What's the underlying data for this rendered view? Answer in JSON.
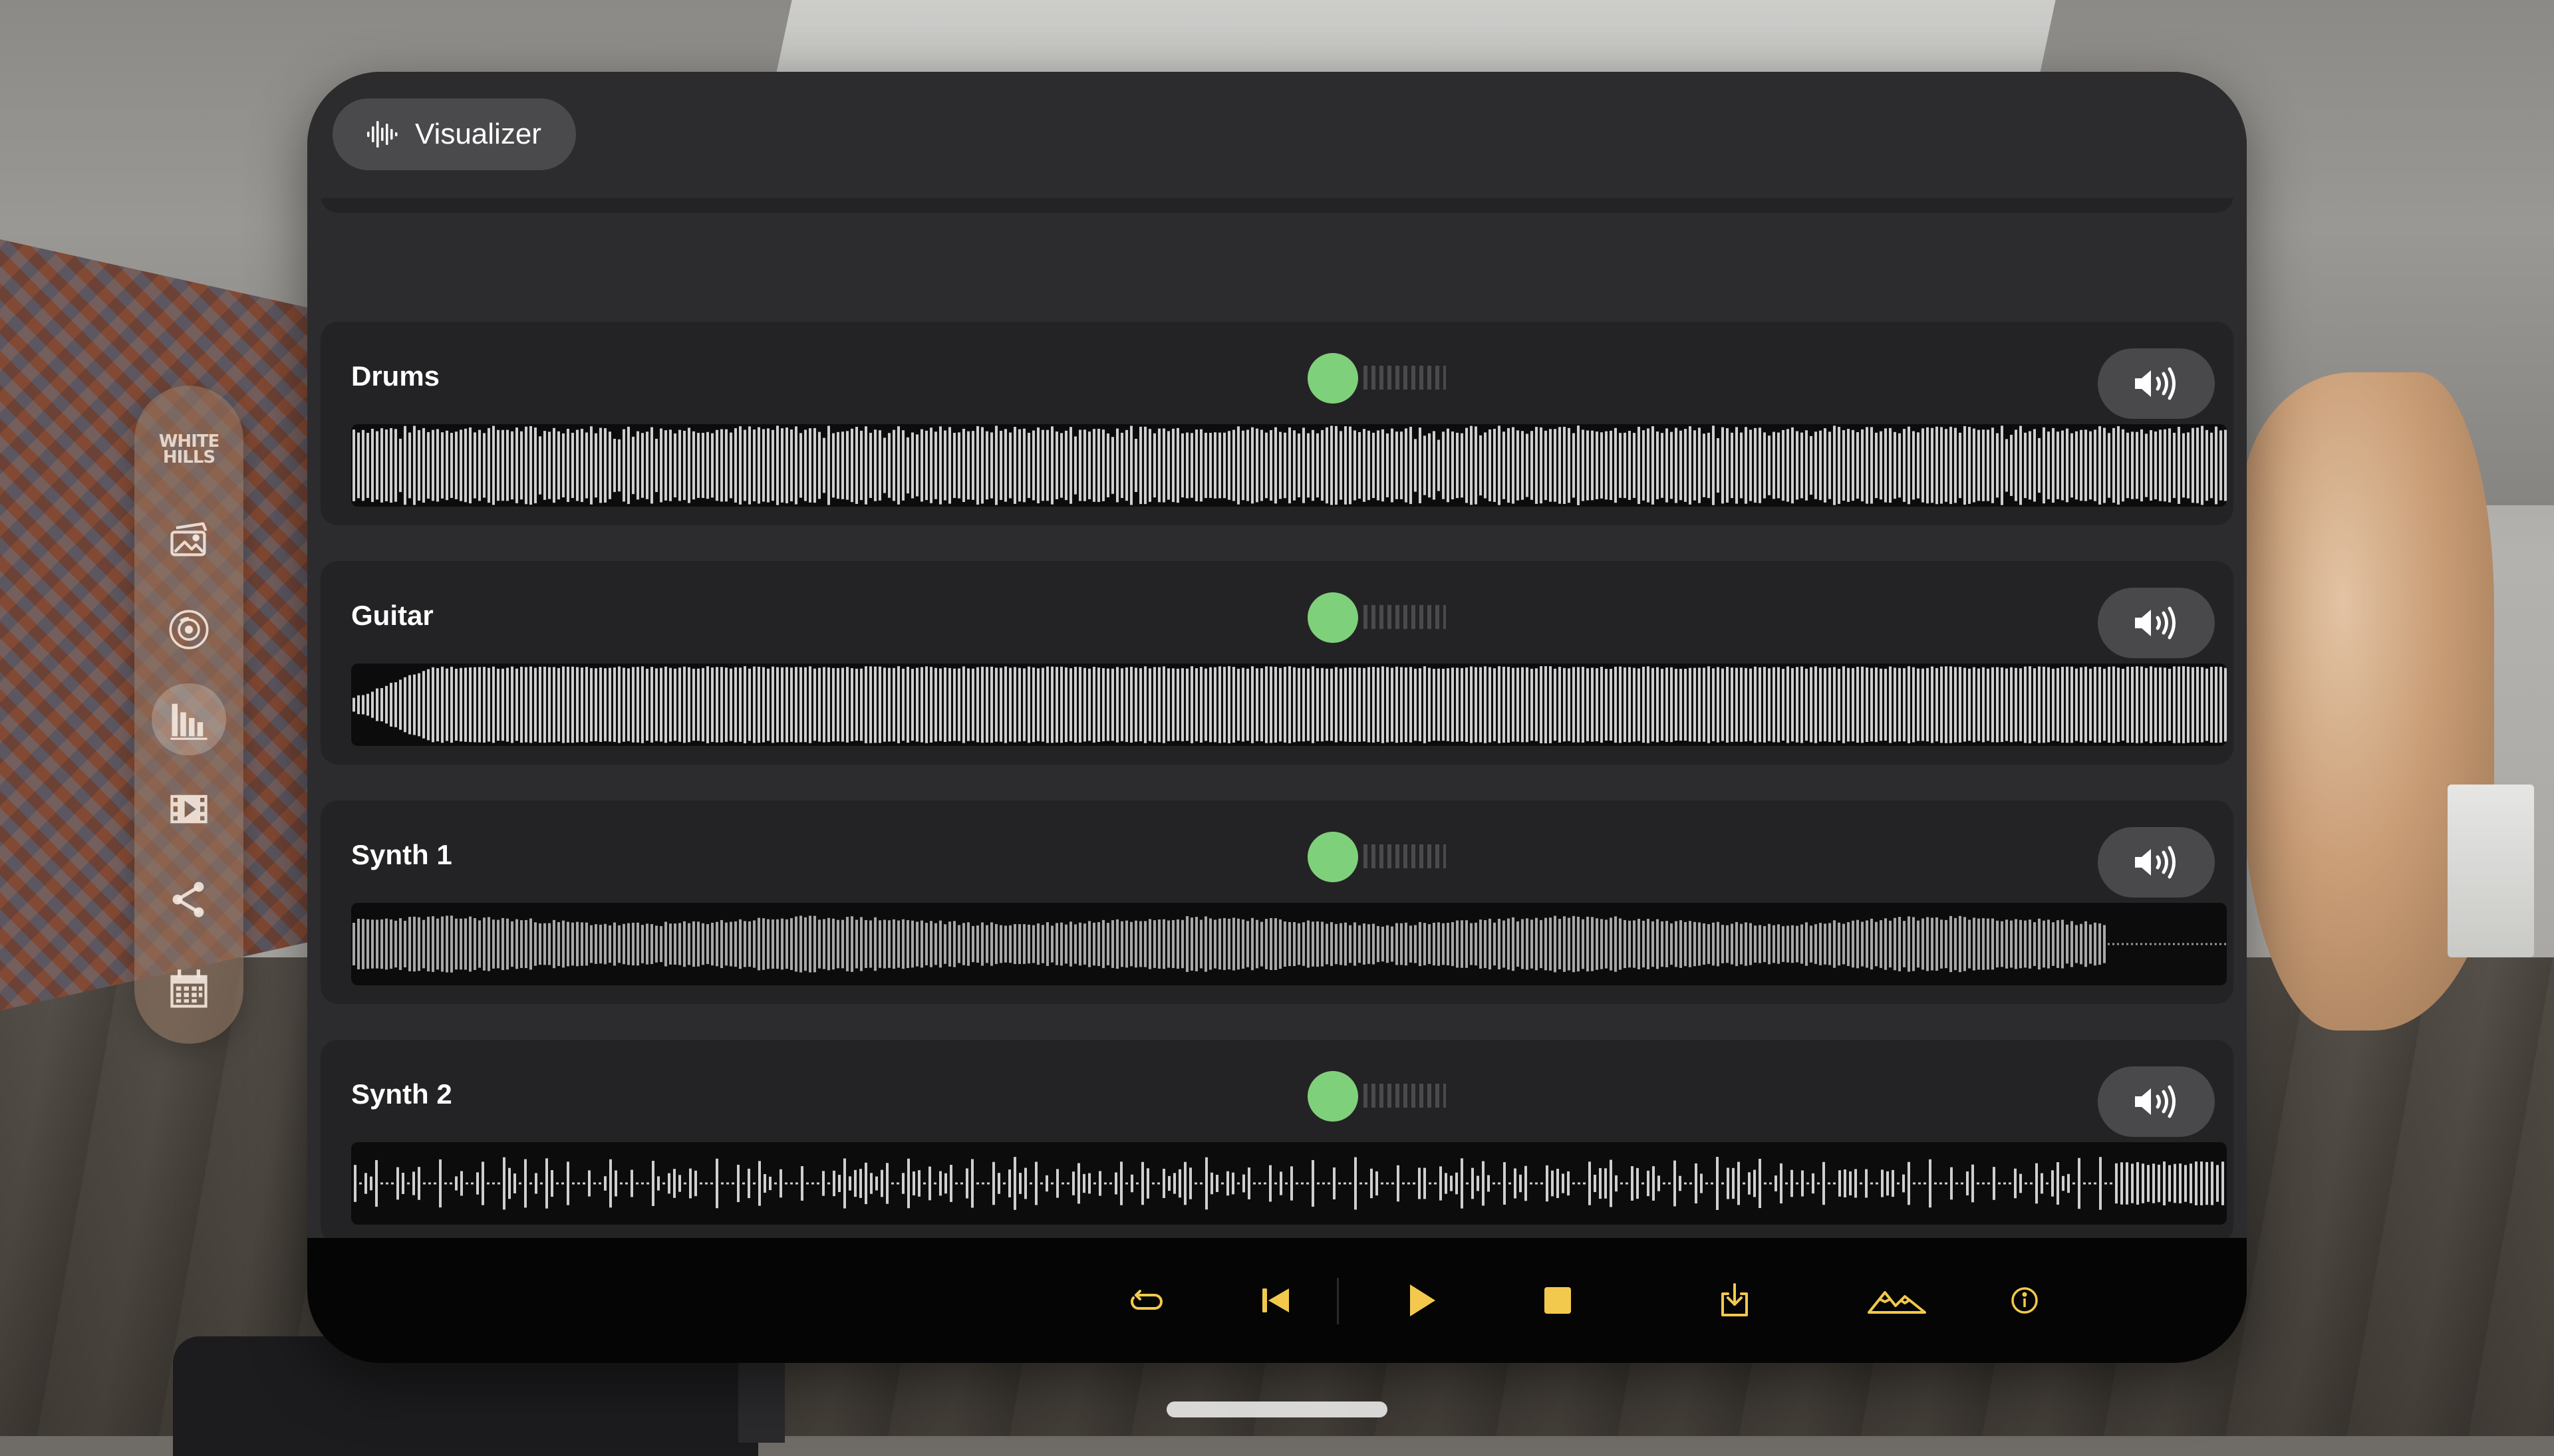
{
  "header": {
    "title": "Visualizer",
    "icon": "waveform-icon"
  },
  "ornament": {
    "logo_line1": "WHITE",
    "logo_line2": "HILLS",
    "items": [
      {
        "name": "photo-gallery-icon"
      },
      {
        "name": "vinyl-disc-icon"
      },
      {
        "name": "visualizer-bars-icon",
        "active": true
      },
      {
        "name": "video-play-icon"
      },
      {
        "name": "share-icon"
      },
      {
        "name": "calendar-icon"
      }
    ]
  },
  "tracks": [
    {
      "name": "Drums",
      "volume_on": true
    },
    {
      "name": "Guitar",
      "volume_on": true
    },
    {
      "name": "Synth 1",
      "volume_on": true
    },
    {
      "name": "Synth 2",
      "volume_on": true
    }
  ],
  "toolbar": {
    "buttons": [
      {
        "name": "loop-icon"
      },
      {
        "name": "skip-back-icon"
      },
      {
        "name": "play-icon"
      },
      {
        "name": "stop-icon"
      },
      {
        "name": "download-icon"
      },
      {
        "name": "mountains-icon"
      },
      {
        "name": "info-icon"
      }
    ]
  },
  "colors": {
    "accent": "#f2c94c",
    "toggle_on": "#7fd07a",
    "window_bg": "#2c2c2e",
    "card_bg": "#232325",
    "wave_bg": "#0c0c0c",
    "wave_bar": "#cfcfcf"
  }
}
